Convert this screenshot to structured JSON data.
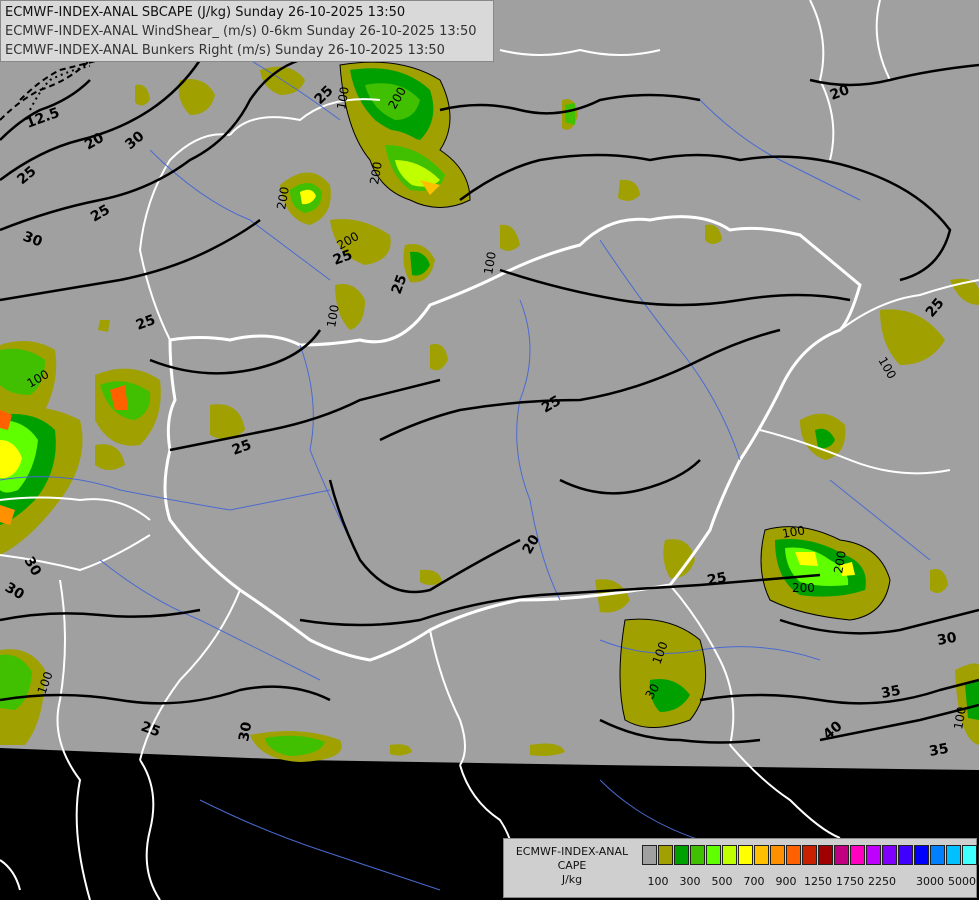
{
  "header": {
    "lines": [
      "ECMWF-INDEX-ANAL SBCAPE (J/kg) Sunday 26-10-2025 13:50",
      "ECMWF-INDEX-ANAL WindShear_ (m/s) 0-6km Sunday 26-10-2025 13:50",
      "ECMWF-INDEX-ANAL Bunkers Right (m/s) Sunday 26-10-2025 13:50"
    ]
  },
  "colorbar": {
    "title_line1": "ECMWF-INDEX-ANAL",
    "title_line2": "CAPE",
    "title_line3": "J/kg",
    "swatch_colors": [
      "#a0a0a0",
      "#a0a000",
      "#00a000",
      "#40c000",
      "#60ff00",
      "#c0ff00",
      "#ffff00",
      "#ffc000",
      "#ff9000",
      "#ff6000",
      "#c82000",
      "#a00000",
      "#c00080",
      "#ff00c0",
      "#c000ff",
      "#8000ff",
      "#4000ff",
      "#0000ff",
      "#0080ff",
      "#00c0ff",
      "#40ffff",
      "#c0ffff"
    ],
    "tick_labels": [
      "100",
      "300",
      "500",
      "700",
      "900",
      "1250",
      "1750",
      "2250",
      "3000",
      "5000"
    ]
  },
  "contour_labels": {
    "shear": [
      "12.5",
      "20",
      "25",
      "30",
      "25",
      "30",
      "25",
      "25",
      "25",
      "25",
      "25",
      "25",
      "20",
      "25",
      "20",
      "30",
      "30",
      "25",
      "25",
      "30",
      "30",
      "35",
      "35",
      "40"
    ],
    "cape": [
      "100",
      "200",
      "200",
      "100",
      "200",
      "100",
      "100",
      "100",
      "100",
      "100",
      "200",
      "200",
      "100",
      "30",
      "100",
      "200"
    ]
  },
  "colors": {
    "land": "#a0a0a0",
    "outside": "#000000",
    "border": "#ffffff",
    "river": "#4060d0",
    "contour": "#000000"
  }
}
